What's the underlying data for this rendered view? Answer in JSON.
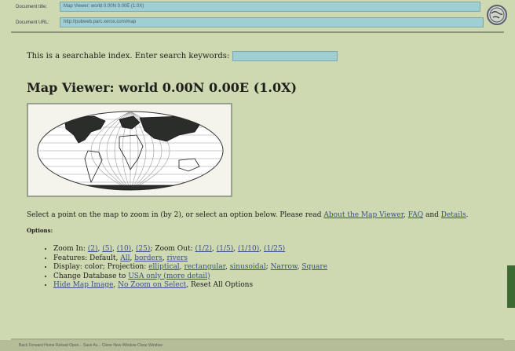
{
  "header": {
    "row1_label": "Document title:",
    "row1_value": "Map Viewer: world 0.00N 0.00E (1.0X)",
    "row2_label": "Document URL:",
    "row2_value": "http://pubweb.parc.xerox.com/map"
  },
  "page": {
    "search_prompt": "This is a searchable index. Enter search keywords:",
    "title": "Map Viewer: world 0.00N 0.00E (1.0X)",
    "desc_text": "Select a point on the map to zoom in (by 2), or select an option below. Please read ",
    "about_link": "About the Map Viewer",
    "faq_link": "FAQ",
    "and_text": " and ",
    "details_link": "Details",
    "options_label": "Options:"
  },
  "options": {
    "zoom_in_label": "Zoom In: ",
    "zoom_in_links": [
      "(2)",
      "(5)",
      "(10)",
      "(25)"
    ],
    "zoom_out_label": "Zoom Out: ",
    "zoom_out_links": [
      "(1/2)",
      "(1/5)",
      "(1/10)",
      "(1/25)"
    ],
    "features_label": "Features: Default, ",
    "features_all": "All",
    "features_borders": "borders",
    "features_rivers": "rivers",
    "display_label": "Display: color; Projection: ",
    "proj_elliptical": "elliptical",
    "proj_rectangular": "rectangular",
    "proj_sinusoidal": "sinusoidal",
    "narrow": "Narrow",
    "square": "Square",
    "database_label": "Change Database to ",
    "usa_link": "USA only (more detail)",
    "hide_link": "Hide Map Image",
    "nozoom_link": "No Zoom on Select",
    "reset_text": ", Reset All Options"
  },
  "status": {
    "text": "Back  Forward  Home  Reload  Open...  Save As...  Clone  New Window  Close Window"
  },
  "colors": {
    "background": "#ced9b2",
    "field": "#9fcfd3",
    "link": "#3a4f8a"
  },
  "icons": [
    "globe-icon",
    "bullet-icon"
  ]
}
